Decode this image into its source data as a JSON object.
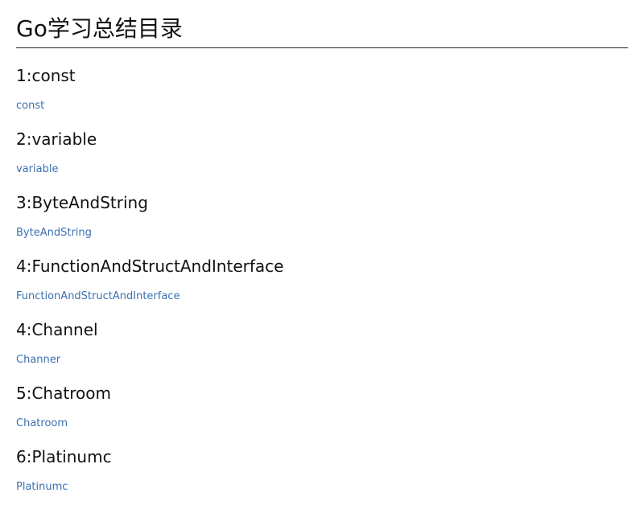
{
  "title": "Go学习总结目录",
  "sections": [
    {
      "heading": "1:const",
      "link": "const"
    },
    {
      "heading": "2:variable",
      "link": "variable"
    },
    {
      "heading": "3:ByteAndString",
      "link": "ByteAndString"
    },
    {
      "heading": "4:FunctionAndStructAndInterface",
      "link": "FunctionAndStructAndInterface"
    },
    {
      "heading": "4:Channel",
      "link": "Channer"
    },
    {
      "heading": "5:Chatroom",
      "link": "Chatroom"
    },
    {
      "heading": "6:Platinumc",
      "link": "Platinumc"
    }
  ],
  "colors": {
    "link": "#3a70b0",
    "text": "#111111",
    "rule": "#222222"
  }
}
